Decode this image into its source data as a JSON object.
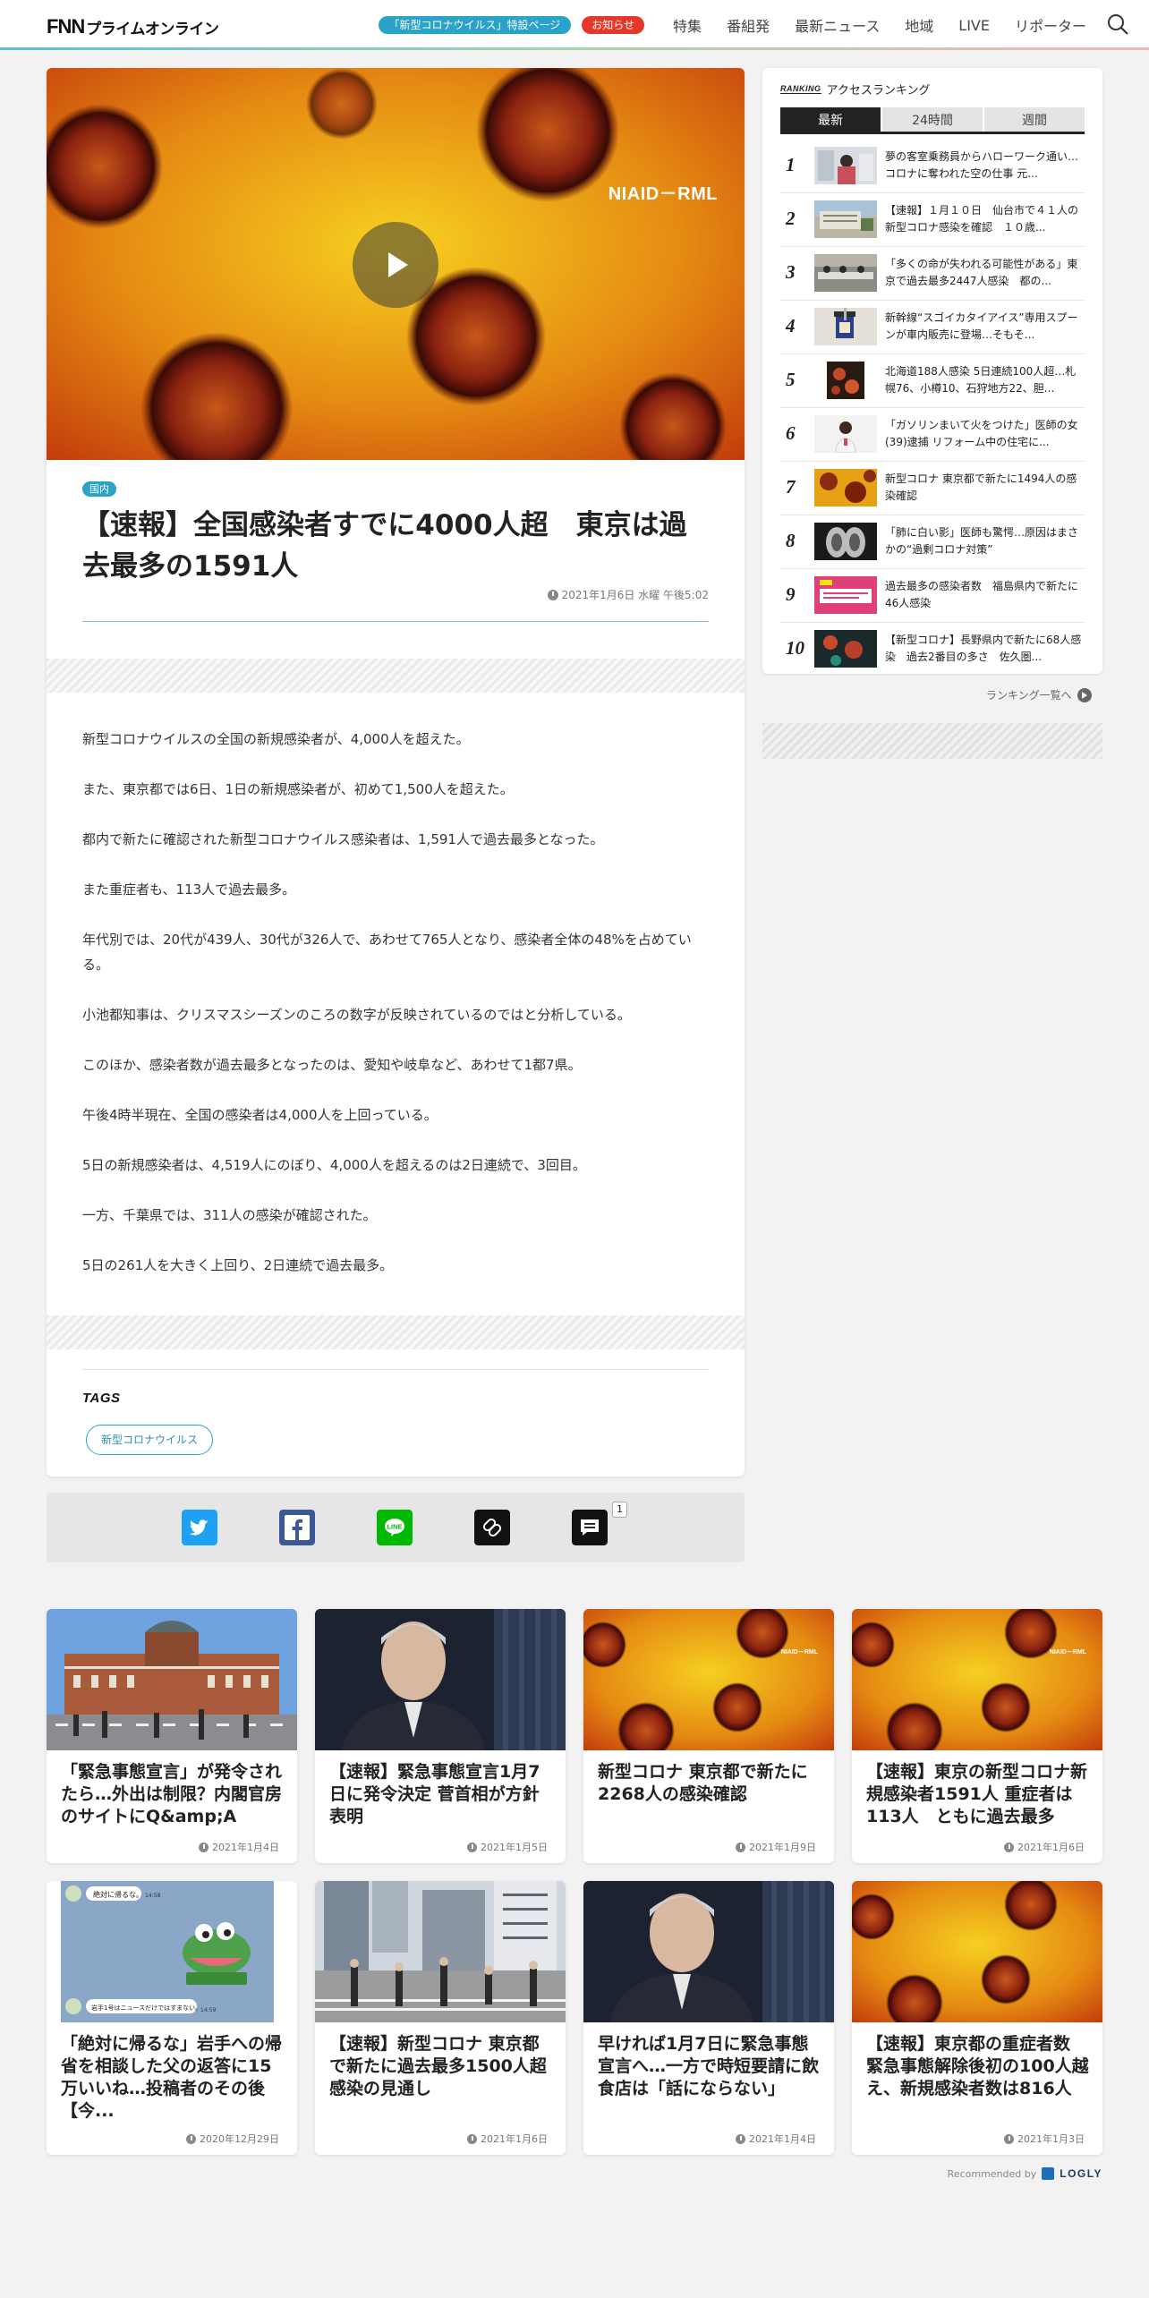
{
  "header": {
    "logo_fnn": "FNN",
    "logo_prime": "プライムオンライン",
    "special_pill": "「新型コロナウイルス」特設ページ",
    "notice_pill": "お知らせ",
    "nav": [
      "特集",
      "番組発",
      "最新ニュース",
      "地域",
      "LIVE",
      "リポーター"
    ]
  },
  "article": {
    "image_caption": "NIAID－RML",
    "category": "国内",
    "title": "【速報】全国感染者すでに4000人超　東京は過去最多の1591人",
    "date": "2021年1月6日 水曜 午後5:02",
    "paragraphs": [
      "新型コロナウイルスの全国の新規感染者が、4,000人を超えた。",
      "また、東京都では6日、1日の新規感染者が、初めて1,500人を超えた。",
      "都内で新たに確認された新型コロナウイルス感染者は、1,591人で過去最多となった。",
      "また重症者も、113人で過去最多。",
      "年代別では、20代が439人、30代が326人で、あわせて765人となり、感染者全体の48%を占めている。",
      "小池都知事は、クリスマスシーズンのころの数字が反映されているのではと分析している。",
      "このほか、感染者数が過去最多となったのは、愛知や岐阜など、あわせて1都7県。",
      "午後4時半現在、全国の感染者は4,000人を上回っている。",
      "5日の新規感染者は、4,519人にのぼり、4,000人を超えるのは2日連続で、3回目。",
      "一方、千葉県では、311人の感染が確認された。",
      "5日の261人を大きく上回り、2日連続で過去最多。"
    ],
    "tags_title": "TAGS",
    "tags": [
      "新型コロナウイルス"
    ]
  },
  "share": {
    "comment_count": "1",
    "colors": {
      "twitter": "#1da1f2",
      "facebook": "#3b5998",
      "line": "#00b900",
      "link": "#111111",
      "comment": "#111111"
    }
  },
  "ranking": {
    "label": "RANKING",
    "title": "アクセスランキング",
    "tabs": [
      "最新",
      "24時間",
      "週間"
    ],
    "active_tab": "最新",
    "items": [
      {
        "rank": "1",
        "text": "夢の客室乗務員からハローワーク通い…コロナに奪われた空の仕事 元..."
      },
      {
        "rank": "2",
        "text": "【速報】１月１０日　仙台市で４１人の新型コロナ感染を確認　１０歳..."
      },
      {
        "rank": "3",
        "text": "「多くの命が失われる可能性がある」東京で過去最多2447人感染　都の..."
      },
      {
        "rank": "4",
        "text": "新幹線“スゴイカタイアイス”専用スプーンが車内販売に登場…そもそ..."
      },
      {
        "rank": "5",
        "text": "北海道188人感染 5日連続100人超…札幌76、小樽10、石狩地方22、胆..."
      },
      {
        "rank": "6",
        "text": "「ガソリンまいて火をつけた」医師の女(39)逮捕 リフォーム中の住宅に..."
      },
      {
        "rank": "7",
        "text": "新型コロナ 東京都で新たに1494人の感染確認"
      },
      {
        "rank": "8",
        "text": "「肺に白い影」医師も驚愕…原因はまさかの“過剰コロナ対策”"
      },
      {
        "rank": "9",
        "text": "過去最多の感染者数　福島県内で新たに46人感染"
      },
      {
        "rank": "10",
        "text": "【新型コロナ】長野県内で新たに68人感染　過去2番目の多さ　佐久圏..."
      }
    ],
    "more_label": "ランキング一覧へ"
  },
  "recommendations": [
    {
      "title": "「緊急事態宣言」が発令されたら…外出は制限？内閣官房のサイトにQ&amp;A",
      "date": "2021年1月4日",
      "thumb": "station"
    },
    {
      "title": "【速報】緊急事態宣言1月7日に発令決定 菅首相が方針表明",
      "date": "2021年1月5日",
      "thumb": "suga"
    },
    {
      "title": "新型コロナ 東京都で新たに2268人の感染確認",
      "date": "2021年1月9日",
      "thumb": "virus"
    },
    {
      "title": "【速報】東京の新型コロナ新規感染者1591人 重症者は113人　ともに過去最多",
      "date": "2021年1月6日",
      "thumb": "virus"
    },
    {
      "title": "「絶対に帰るな」岩手への帰省を相談した父の返答に15万いいね…投稿者のその後【今...",
      "date": "2020年12月29日",
      "thumb": "chat"
    },
    {
      "title": "【速報】新型コロナ 東京都で新たに過去最多1500人超感染の見通し",
      "date": "2021年1月6日",
      "thumb": "street"
    },
    {
      "title": "早ければ1月7日に緊急事態宣言へ…一方で時短要請に飲食店は「話にならない」",
      "date": "2021年1月4日",
      "thumb": "suga"
    },
    {
      "title": "【速報】東京都の重症者数 緊急事態解除後初の100人越え、新規感染者数は816人",
      "date": "2021年1月3日",
      "thumb": "virus"
    }
  ],
  "chat_thumb": {
    "msg1": "絶対に帰るな。",
    "msg2": "岩手1号はニュースだけではすまない。",
    "time1": "14:58",
    "time2": "14:59"
  },
  "recommended_by": "Recommended by",
  "logly": "LOGLY"
}
